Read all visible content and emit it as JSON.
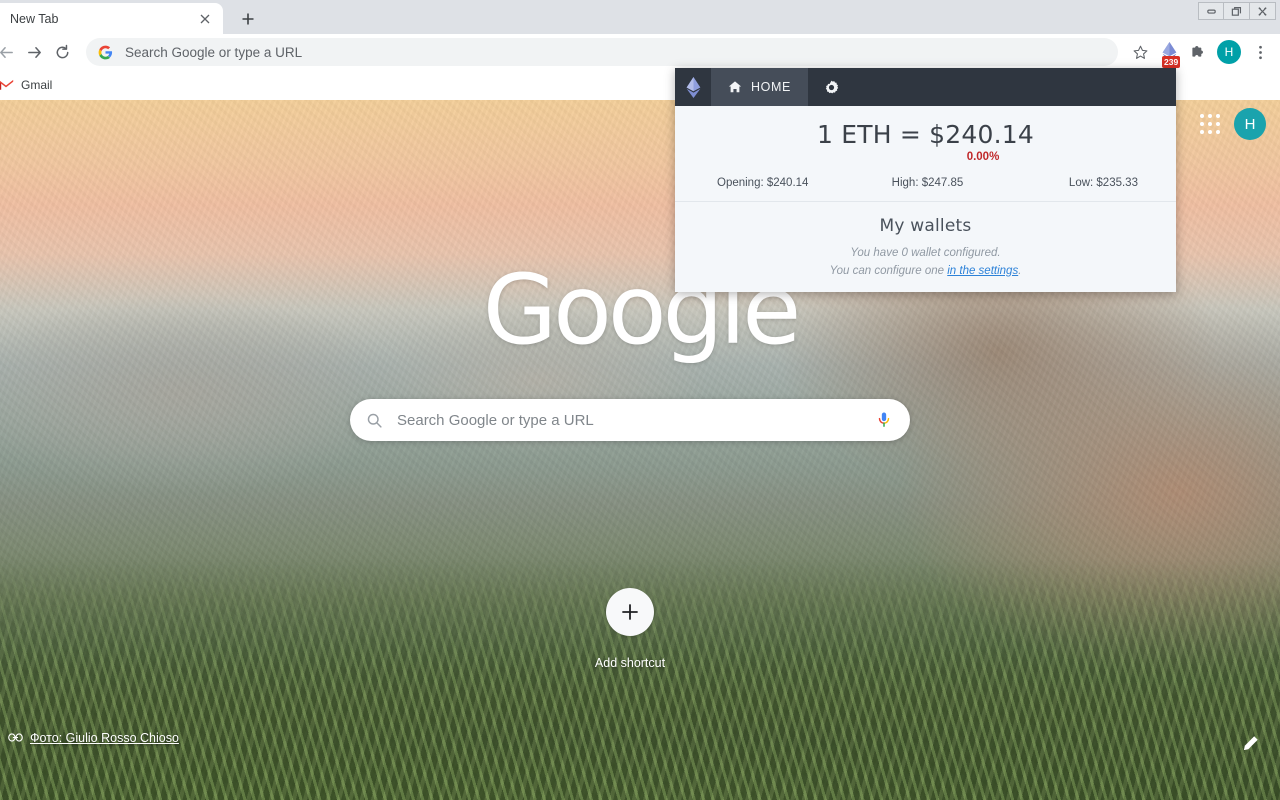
{
  "browser": {
    "tab": {
      "title": "New Tab",
      "close_icon": "close-icon"
    },
    "new_tab_button": "+",
    "window_controls": {
      "minimize": "minimize-icon",
      "maximize": "maximize-icon",
      "close": "close-icon"
    },
    "toolbar": {
      "back": "back-arrow-icon",
      "forward": "forward-arrow-icon",
      "reload": "reload-icon",
      "omnibox_text": "Search Google or type a URL",
      "omnibox_placeholder": "Search Google or type a URL",
      "bookmark_star": "star-icon",
      "extension_icon": "ethereum-extension-icon",
      "extension_badge": "239",
      "extensions_puzzle": "puzzle-icon",
      "profile_initial": "H",
      "menu": "three-dot-menu-icon"
    },
    "bookmarks": [
      {
        "label": "Gmail",
        "icon": "gmail-icon"
      }
    ]
  },
  "newtab": {
    "apps_grid_icon": "apps-grid-icon",
    "avatar_initial": "H",
    "wordmark": "Google",
    "search": {
      "placeholder": "Search Google or type a URL",
      "value": "Search Google or type a URL",
      "search_icon": "search-icon",
      "mic_icon": "microphone-icon"
    },
    "shortcut": {
      "label": "Add shortcut",
      "icon": "plus-icon"
    },
    "attribution": {
      "text": "Фото: Giulio Rosso Chioso",
      "icon": "link-icon"
    },
    "customize_icon": "pencil-icon"
  },
  "popup": {
    "nav": {
      "logo_icon": "ethereum-diamond-icon",
      "home_label": "HOME",
      "home_icon": "home-icon",
      "settings_icon": "gear-icon"
    },
    "price": {
      "headline": "1 ETH = $240.14",
      "change": "0.00%",
      "change_color": "#c0282a",
      "opening": "Opening: $240.14",
      "high": "High: $247.85",
      "low": "Low: $235.33"
    },
    "wallets": {
      "title": "My wallets",
      "line1": "You have 0 wallet configured.",
      "line2_prefix": "You can configure one ",
      "line2_link": "in the settings",
      "line2_suffix": "."
    }
  }
}
